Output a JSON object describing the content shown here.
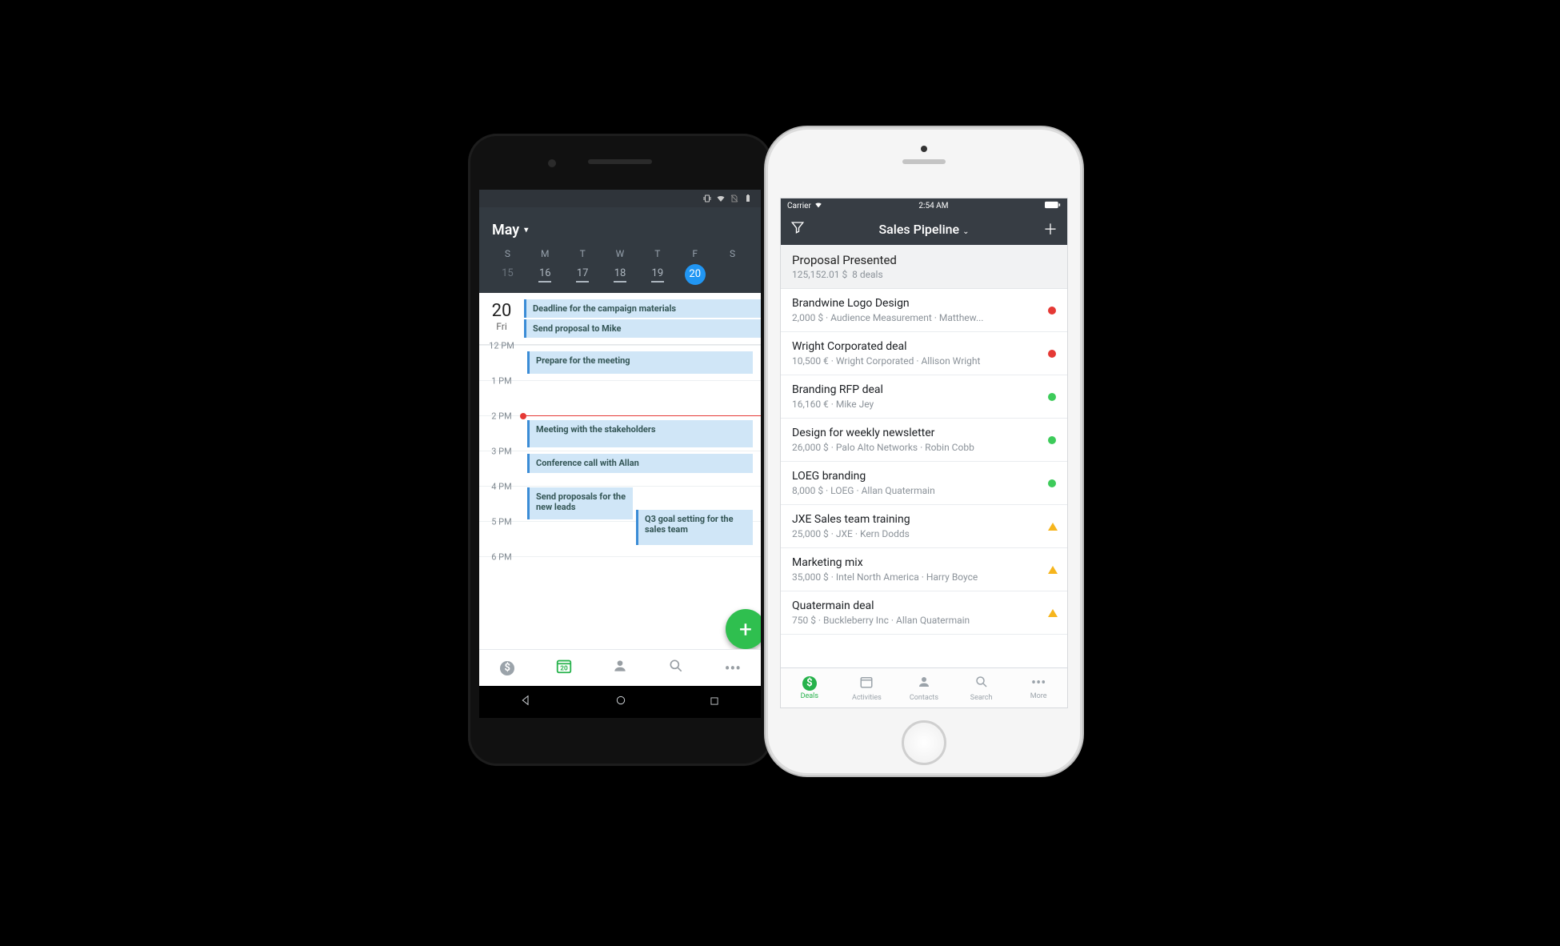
{
  "android": {
    "month": "May",
    "week": {
      "days": [
        "S",
        "M",
        "T",
        "W",
        "T",
        "F",
        "S"
      ],
      "nums": [
        "15",
        "16",
        "17",
        "18",
        "19",
        "20",
        ""
      ]
    },
    "selected": {
      "num": "20",
      "weekday": "Fri"
    },
    "allday": [
      "Deadline for the campaign materials",
      "Send proposal to Mike"
    ],
    "hours": [
      "12 PM",
      "1 PM",
      "2 PM",
      "3 PM",
      "4 PM",
      "5 PM",
      "6 PM"
    ],
    "events": {
      "e1": "Prepare for the meeting",
      "e2": "Meeting with the stakeholders",
      "e3": "Conference call with Allan",
      "e4": "Send proposals for the new leads",
      "e5": "Q3 goal setting for the sales team"
    },
    "tabs": [
      "$",
      "20",
      "person",
      "search",
      "•••"
    ]
  },
  "ios": {
    "status": {
      "carrier": "Carrier",
      "time": "2:54 AM"
    },
    "header_title": "Sales Pipeline",
    "stage": {
      "title": "Proposal Presented",
      "value": "125,152.01 $",
      "count": "8 deals"
    },
    "deals": [
      {
        "title": "Brandwine Logo Design",
        "sub": "2,000 $  ·  Audience Measurement  ·  Matthew...",
        "status": "red"
      },
      {
        "title": "Wright Corporated deal",
        "sub": "10,500 €  ·  Wright Corporated  ·  Allison Wright",
        "status": "red"
      },
      {
        "title": "Branding RFP deal",
        "sub": "16,160 €  ·  Mike Jey",
        "status": "green"
      },
      {
        "title": "Design for weekly newsletter",
        "sub": "26,000 $  ·  Palo Alto Networks  ·  Robin Cobb",
        "status": "green"
      },
      {
        "title": "LOEG branding",
        "sub": "8,000 $  ·  LOEG  ·  Allan Quatermain",
        "status": "green"
      },
      {
        "title": "JXE Sales team training",
        "sub": "25,000 $  ·  JXE  ·  Kern Dodds",
        "status": "warn"
      },
      {
        "title": "Marketing mix",
        "sub": "35,000 $  ·  Intel North America  ·  Harry Boyce",
        "status": "warn"
      },
      {
        "title": "Quatermain deal",
        "sub": "750 $  ·  Buckleberry Inc  ·  Allan Quatermain",
        "status": "warn"
      }
    ],
    "tabs": [
      {
        "key": "deals",
        "label": "Deals"
      },
      {
        "key": "activities",
        "label": "Activities"
      },
      {
        "key": "contacts",
        "label": "Contacts"
      },
      {
        "key": "search",
        "label": "Search"
      },
      {
        "key": "more",
        "label": "More"
      }
    ]
  }
}
